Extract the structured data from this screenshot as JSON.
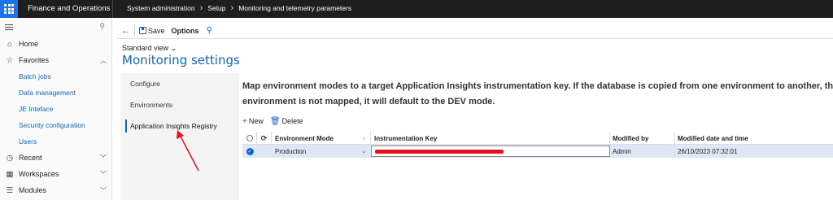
{
  "topbar": {
    "app_title": "Finance and Operations",
    "breadcrumb": [
      "System administration",
      "Setup",
      "Monitoring and telemetry parameters"
    ]
  },
  "nav": {
    "home": "Home",
    "favorites": "Favorites",
    "favorites_items": [
      "Batch jobs",
      "Data management",
      "JE Inteface",
      "Security configuration",
      "Users"
    ],
    "recent": "Recent",
    "workspaces": "Workspaces",
    "modules": "Modules"
  },
  "actionpane": {
    "save_label": "Save",
    "options_label": "Options"
  },
  "page": {
    "view_label": "Standard view",
    "title": "Monitoring settings"
  },
  "tabs": [
    "Configure",
    "Environments",
    "Application Insights Registry"
  ],
  "content": {
    "description_line1": "Map environment modes to a target Application Insights instrumentation key. If the database is copied from one environment to another, the r",
    "description_line2": "environment is not mapped, it will default to the DEV mode.",
    "new_label": "New",
    "delete_label": "Delete"
  },
  "grid": {
    "headers": [
      "Environment Mode",
      "Instrumentation Key",
      "Modified by",
      "Modified date and time"
    ],
    "rows": [
      {
        "mode": "Production",
        "key": "",
        "modified_by": "Admin",
        "modified_at": "26/10/2023 07:32:01"
      }
    ]
  },
  "colors": {
    "accent": "#1565c0",
    "topbar": "#1e1e1e",
    "waffle": "#1a73e8",
    "selected_row": "#dde7f5",
    "annotation": "#e8121a"
  }
}
